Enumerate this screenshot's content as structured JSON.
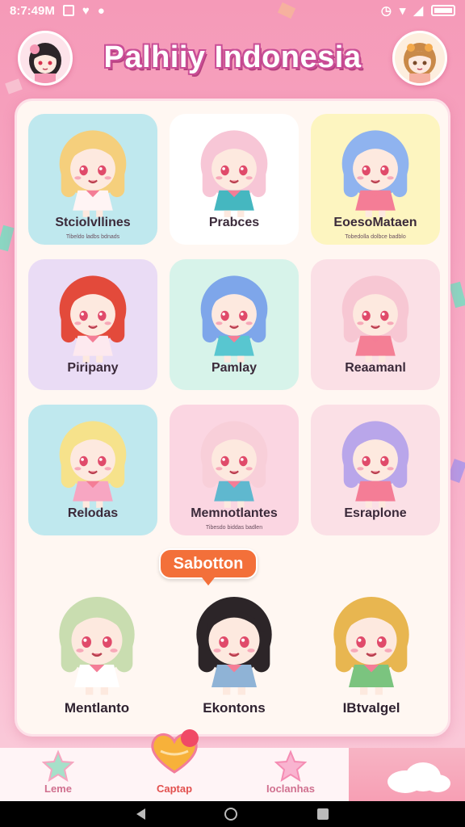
{
  "status": {
    "time": "8:7:49M",
    "icons": [
      "sim-icon",
      "heart-icon",
      "dot-icon"
    ],
    "right_icons": [
      "alarm-icon",
      "wifi-icon",
      "signal-icon",
      "battery-icon"
    ]
  },
  "header": {
    "title": "Palhiiy Indonesia"
  },
  "grid": [
    {
      "name": "Stciolvllines",
      "sub": "Tibeldo ladbs bdnads",
      "bg": "#bfe8ee",
      "hair": "#f5cf7c",
      "outfit": "#fff4f4"
    },
    {
      "name": "Prabces",
      "sub": "",
      "bg": "#ffffff",
      "hair": "#f7c6d6",
      "outfit": "#45b7c0"
    },
    {
      "name": "EoesoMataen",
      "sub": "Tobedolla dolbce badblo",
      "bg": "#fdf5c0",
      "hair": "#8fb3ef",
      "outfit": "#f47d96"
    },
    {
      "name": "Piripany",
      "sub": "",
      "bg": "#eadcf5",
      "hair": "#e34a3b",
      "outfit": "#fde9ef"
    },
    {
      "name": "Pamlay",
      "sub": "",
      "bg": "#d7f3ea",
      "hair": "#7ea6ea",
      "outfit": "#58c6d0"
    },
    {
      "name": "Reaamanl",
      "sub": "",
      "bg": "#fbe0e6",
      "hair": "#f7c7d3",
      "outfit": "#f47f95"
    },
    {
      "name": "Relodas",
      "sub": "",
      "bg": "#bfe8ee",
      "hair": "#f6e28b",
      "outfit": "#f7a6c2"
    },
    {
      "name": "Memnotlantes",
      "sub": "Tibesdo biddas badlen",
      "bg": "#fbd6e2",
      "hair": "#f8cfd9",
      "outfit": "#5fb8cf"
    },
    {
      "name": "Esraplone",
      "sub": "",
      "bg": "#fbe0e6",
      "hair": "#b9a6ea",
      "outfit": "#f47d96"
    }
  ],
  "speech_bubble": "Sabotton",
  "open_row": [
    {
      "name": "Mentlanto",
      "hair": "#c9ddb0",
      "outfit": "#fff"
    },
    {
      "name": "Ekontons",
      "hair": "#2c2528",
      "outfit": "#8fb3d6"
    },
    {
      "name": "IBtvalgel",
      "hair": "#e8b650",
      "outfit": "#7bc47f"
    }
  ],
  "bottom_nav": [
    {
      "label": "Leme",
      "icon": "star-icon"
    },
    {
      "label": "Captap",
      "icon": "heart-icon"
    },
    {
      "label": "Ioclanhas",
      "icon": "star-icon"
    }
  ]
}
